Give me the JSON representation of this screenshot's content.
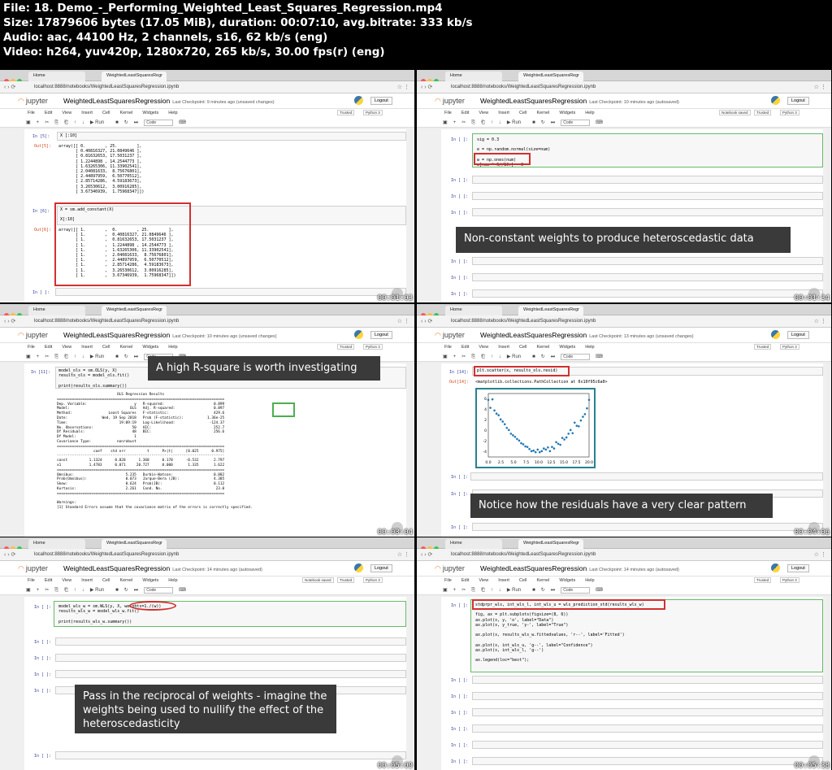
{
  "header": {
    "line1": "File: 18. Demo_-_Performing_Weighted_Least_Squares_Regression.mp4",
    "line2": "Size: 17879606 bytes (17.05 MiB), duration: 00:07:10, avg.bitrate: 333 kb/s",
    "line3": "Audio: aac, 44100 Hz, 2 channels, s16, 62 kb/s (eng)",
    "line4": "Video: h264, yuv420p, 1280x720, 265 kb/s, 30.00 fps(r) (eng)"
  },
  "browser": {
    "tab_home": "Home",
    "tab_nb": "WeightedLeastSquaresRegr",
    "url": "localhost:8888/notebooks/WeightedLeastSquaresRegression.ipynb"
  },
  "jupyter": {
    "logo": "jupyter",
    "title": "WeightedLeastSquaresRegression",
    "logout": "Logout",
    "trusted": "Trusted",
    "kernel": "Python 3",
    "notebook_saved": "Notebook saved",
    "menus": [
      "File",
      "Edit",
      "View",
      "Insert",
      "Cell",
      "Kernel",
      "Widgets",
      "Help"
    ],
    "run": "Run",
    "celltype": "Code"
  },
  "frames": [
    {
      "checkpoint": "Last Checkpoint: 9 minutes ago",
      "status": "(unsaved changes)",
      "timestamp": "00:01:03",
      "in5": "In [5]:",
      "code5": "X [:10]",
      "out5": "Out[5]:",
      "array5": "array([[ 0.        , 25.        ],\n       [ 0.40816327, 21.0849646 ],\n       [ 0.81632653, 17.5031237 ],\n       [ 1.2244898 , 14.2544773 ],\n       [ 1.63265306, 11.33902541],\n       [ 2.04081633,  8.75676801],\n       [ 2.44897959,  6.50770512],\n       [ 2.85714286,  4.59183673],\n       [ 3.26530612,  3.00916285],\n       [ 3.67346939,  1.75968347]])",
      "in6": "In [6]:",
      "code6": "X = sm.add_constant(X)\n\nX[:10]",
      "out6": "Out[6]:",
      "array6": "array([[ 1.        ,  0.        , 25.        ],\n       [ 1.        ,  0.40816327, 21.0849646 ],\n       [ 1.        ,  0.81632653, 17.5031237 ],\n       [ 1.        ,  1.2244898 , 14.2544773 ],\n       [ 1.        ,  1.63265306, 11.33902541],\n       [ 1.        ,  2.04081633,  8.75676801],\n       [ 1.        ,  2.44897959,  6.50770512],\n       [ 1.        ,  2.85714286,  4.59183673],\n       [ 1.        ,  3.26530612,  3.00916285],\n       [ 1.        ,  3.67346939,  1.75968347]])",
      "in_empty": "In [ ]:"
    },
    {
      "checkpoint": "Last Checkpoint: 10 minutes ago",
      "status": "(autosaved)",
      "timestamp": "00:01:34",
      "in_empty": "In [ ]:",
      "code": "sig = 0.3\n\ne = np.random.normal(size=num)\n\nw = np.ones(num)\nw[num * 6//10:] = 3",
      "caption": "Non-constant weights to produce heteroscedastic data"
    },
    {
      "checkpoint": "Last Checkpoint: 10 minutes ago",
      "status": "(unsaved changes)",
      "timestamp": "00:03:04",
      "in11": "In [11]:",
      "code": "model_ols = sm.OLS(y, X)\nresults_ols = model_ols.fit()\n\nprint(results_ols.summary())",
      "summary": "                            OLS Regression Results\n==============================================================================\nDep. Variable:                      y   R-squared:                       0.899\nModel:                            OLS   Adj. R-squared:                  0.897\nMethod:                 Least Squares   F-statistic:                     429.6\nDate:                Wed, 19 Sep 2018   Prob (F-statistic):           1.36e-25\nTime:                        19:09:19   Log-Likelihood:                -124.37\nNo. Observations:                  50   AIC:                             252.7\nDf Residuals:                      48   BIC:                             256.6\nDf Model:                           1\nCovariance Type:            nonrobust\n==============================================================================\n                 coef    std err          t      P>|t|      [0.025      0.975]\n------------------------------------------------------------------------------\nconst          1.1324      0.828      1.368      0.178      -0.532       2.797\nx1             1.4783      0.071     20.727      0.000       1.335       1.622\n==============================================================================\nOmnibus:                        5.235   Durbin-Watson:                   0.082\nProb(Omnibus):                  0.073   Jarque-Bera (JB):                4.385\nSkew:                           0.624   Prob(JB):                        0.112\nKurtosis:                       2.261   Cond. No.                         23.0\n==============================================================================\n\nWarnings:\n[1] Standard Errors assume that the covariance matrix of the errors is correctly specified.",
      "caption": "A high R-square is worth investigating"
    },
    {
      "checkpoint": "Last Checkpoint: 13 minutes ago",
      "status": "(unsaved changes)",
      "timestamp": "00:04:06",
      "in14": "In [14]:",
      "code": "plt.scatter(x, results_ols.resid)",
      "out14": "Out[14]:",
      "out14_text": "<matplotlib.collections.PathCollection at 0x10f95c6a0>",
      "in_empty": "In [ ]:",
      "caption": "Notice how the residuals have a very clear pattern"
    },
    {
      "checkpoint": "Last Checkpoint: 14 minutes ago",
      "status": "(autosaved)",
      "timestamp": "00:05:09",
      "in_": "In [ ]:",
      "code": "model_wls_w = sm.WLS(y, X, weights=1./(w))\nresults_wls_w = model_wls_w.fit()\n\nprint(results_wls_w.summary())",
      "caption": "Pass in the reciprocal of weights - imagine the weights being used to nullify the effect of the heteroscedasticity"
    },
    {
      "checkpoint": "Last Checkpoint: 14 minutes ago",
      "status": "(autosaved)",
      "timestamp": "00:05:38",
      "in_": "In [ ]:",
      "code": "stdprpr_wls, int_wls_l, int_wls_u = wls_prediction_std(results_wls_w)\n\nfig, ax = plt.subplots(figsize=(8, 6))\nax.plot(x, y, 'o', label=\"Data\")\nax.plot(x, y_true, 'y-', label=\"True\")\n\nax.plot(x, results_wls_w.fittedvalues, 'r--', label='Fitted')\n\nax.plot(x, int_wls_u, 'g--', label=\"Confidence\")\nax.plot(x, int_wls_l, 'g--')\n\nax.legend(loc=\"best\");"
    }
  ],
  "chart_data": {
    "type": "scatter",
    "title": "",
    "xlabel": "",
    "ylabel": "",
    "xticks": [
      "0.0",
      "2.5",
      "5.0",
      "7.5",
      "10.0",
      "12.5",
      "15.0",
      "17.5",
      "20.0"
    ],
    "yticks": [
      "6",
      "4",
      "2",
      "0",
      "-2",
      "-4"
    ],
    "xlim": [
      0,
      20
    ],
    "ylim": [
      -5,
      7
    ],
    "x": [
      0.0,
      0.41,
      0.82,
      1.22,
      1.63,
      2.04,
      2.45,
      2.86,
      3.27,
      3.67,
      4.08,
      4.49,
      4.9,
      5.31,
      5.71,
      6.12,
      6.53,
      6.94,
      7.35,
      7.76,
      8.16,
      8.57,
      8.98,
      9.39,
      9.8,
      10.2,
      10.61,
      11.02,
      11.43,
      11.84,
      12.24,
      12.65,
      13.06,
      13.47,
      13.88,
      14.29,
      14.69,
      15.1,
      15.51,
      15.92,
      16.33,
      16.73,
      17.14,
      17.55,
      17.96,
      18.37,
      18.78,
      19.18,
      19.59,
      20.0
    ],
    "y": [
      5.8,
      4.3,
      5.9,
      3.8,
      3.2,
      2.9,
      2.1,
      1.7,
      1.2,
      0.5,
      0.1,
      -0.6,
      -0.9,
      -1.2,
      -1.6,
      -1.9,
      -2.4,
      -2.6,
      -3.0,
      -3.1,
      -3.5,
      -3.9,
      -3.8,
      -4.1,
      -3.6,
      -4.1,
      -3.9,
      -3.4,
      -3.6,
      -3.2,
      -3.9,
      -3.1,
      -3.4,
      -2.2,
      -2.5,
      -2.7,
      -1.4,
      -1.7,
      -1.3,
      -0.6,
      0.1,
      -0.5,
      1.5,
      0.9,
      0.8,
      1.9,
      2.6,
      3.1,
      4.2,
      5.8
    ]
  }
}
